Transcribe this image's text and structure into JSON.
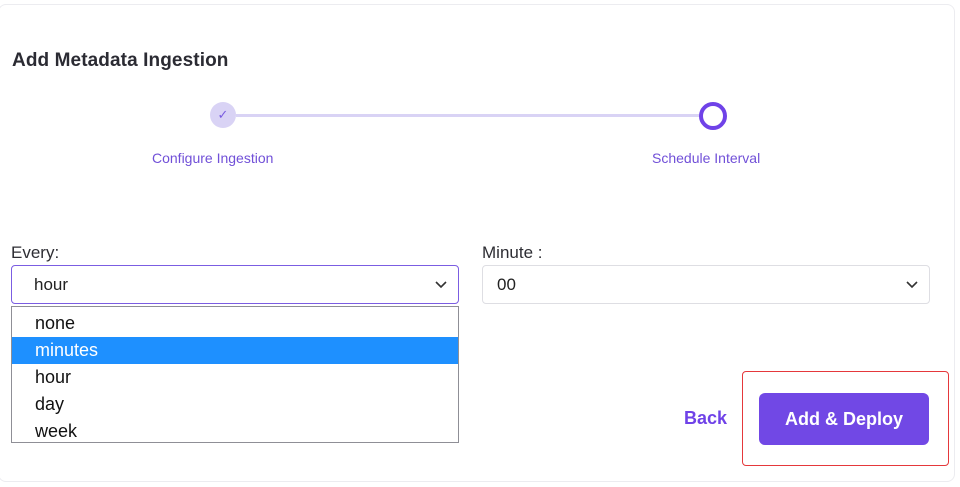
{
  "page": {
    "title": "Add Metadata Ingestion"
  },
  "stepper": {
    "steps": [
      {
        "label": "Configure Ingestion",
        "state": "completed"
      },
      {
        "label": "Schedule Interval",
        "state": "active"
      }
    ],
    "check_glyph": "✓",
    "colors": {
      "accent": "#6f42e8",
      "track": "#d9d3f5"
    }
  },
  "schedule": {
    "every_label": "Every:",
    "every_value": "hour",
    "every_options": [
      "none",
      "minutes",
      "hour",
      "day",
      "week"
    ],
    "every_highlighted": "minutes",
    "minute_label": "Minute :",
    "minute_value": "00"
  },
  "actions": {
    "back_label": "Back",
    "deploy_label": "Add & Deploy"
  },
  "colors": {
    "primary": "#7148e5",
    "option_highlight": "#1e90ff",
    "annotation_box": "#e5383b"
  },
  "icons": {
    "step_done": "check-icon",
    "select_arrow": "chevron-down-icon"
  }
}
